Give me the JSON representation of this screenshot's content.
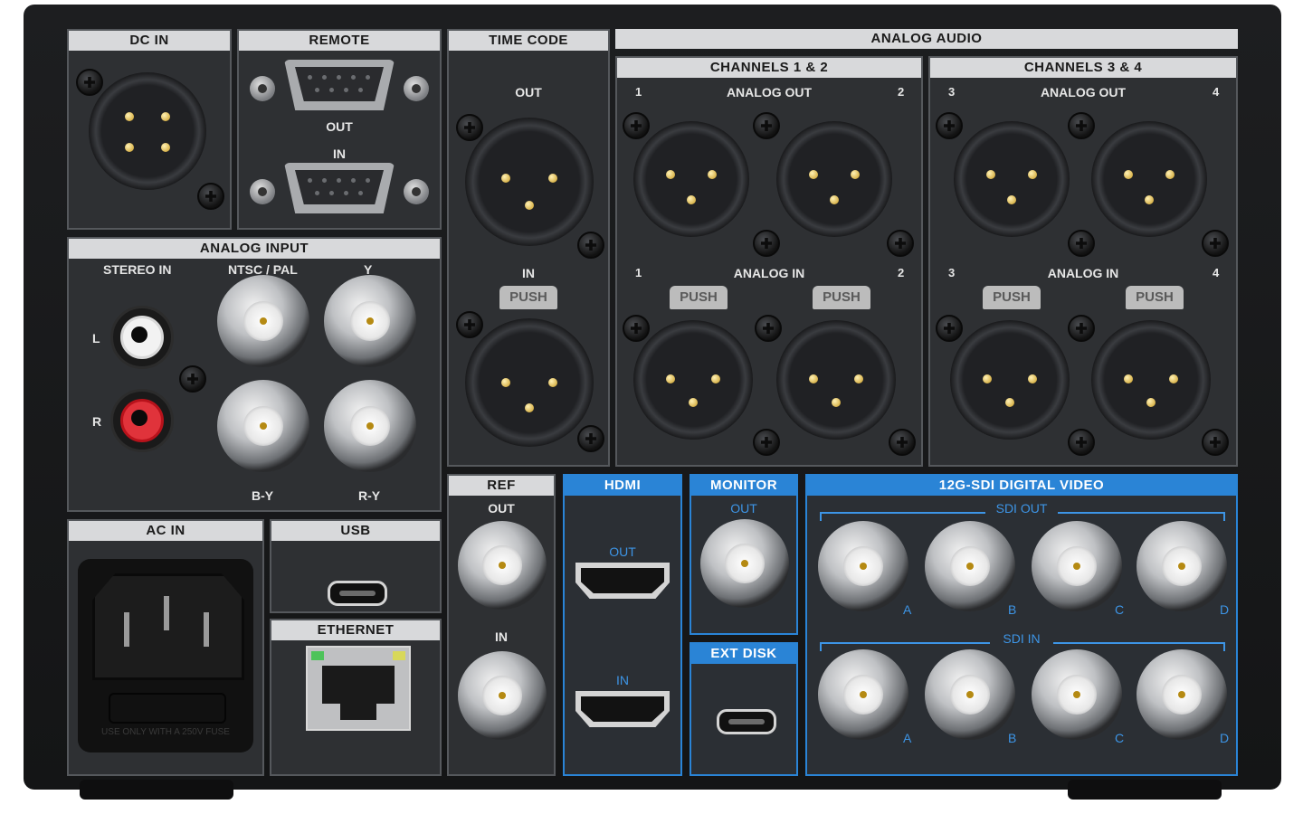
{
  "sections": {
    "dc_in": "DC IN",
    "remote": "REMOTE",
    "time_code": "TIME CODE",
    "analog_audio": "ANALOG AUDIO",
    "channels_12": "CHANNELS 1 & 2",
    "channels_34": "CHANNELS 3 & 4",
    "analog_input": "ANALOG INPUT",
    "ac_in": "AC IN",
    "usb": "USB",
    "ethernet": "ETHERNET",
    "ref": "REF",
    "hdmi": "HDMI",
    "monitor": "MONITOR",
    "ext_disk": "EXT DISK",
    "sdi_video": "12G-SDI DIGITAL VIDEO"
  },
  "labels": {
    "out": "OUT",
    "in": "IN",
    "analog_out": "ANALOG OUT",
    "analog_in": "ANALOG IN",
    "stereo_in": "STEREO IN",
    "ntsc_pal": "NTSC / PAL",
    "y": "Y",
    "by": "B-Y",
    "ry": "R-Y",
    "l": "L",
    "r": "R",
    "sdi_out": "SDI OUT",
    "sdi_in": "SDI IN",
    "push": "PUSH",
    "fuse": "USE ONLY WITH A 250V FUSE",
    "ch1": "1",
    "ch2": "2",
    "ch3": "3",
    "ch4": "4",
    "a": "A",
    "b": "B",
    "c": "C",
    "d": "D"
  },
  "colors": {
    "accent_blue": "#2a84d6",
    "panel": "#2e3033",
    "header": "#d8d9db"
  }
}
